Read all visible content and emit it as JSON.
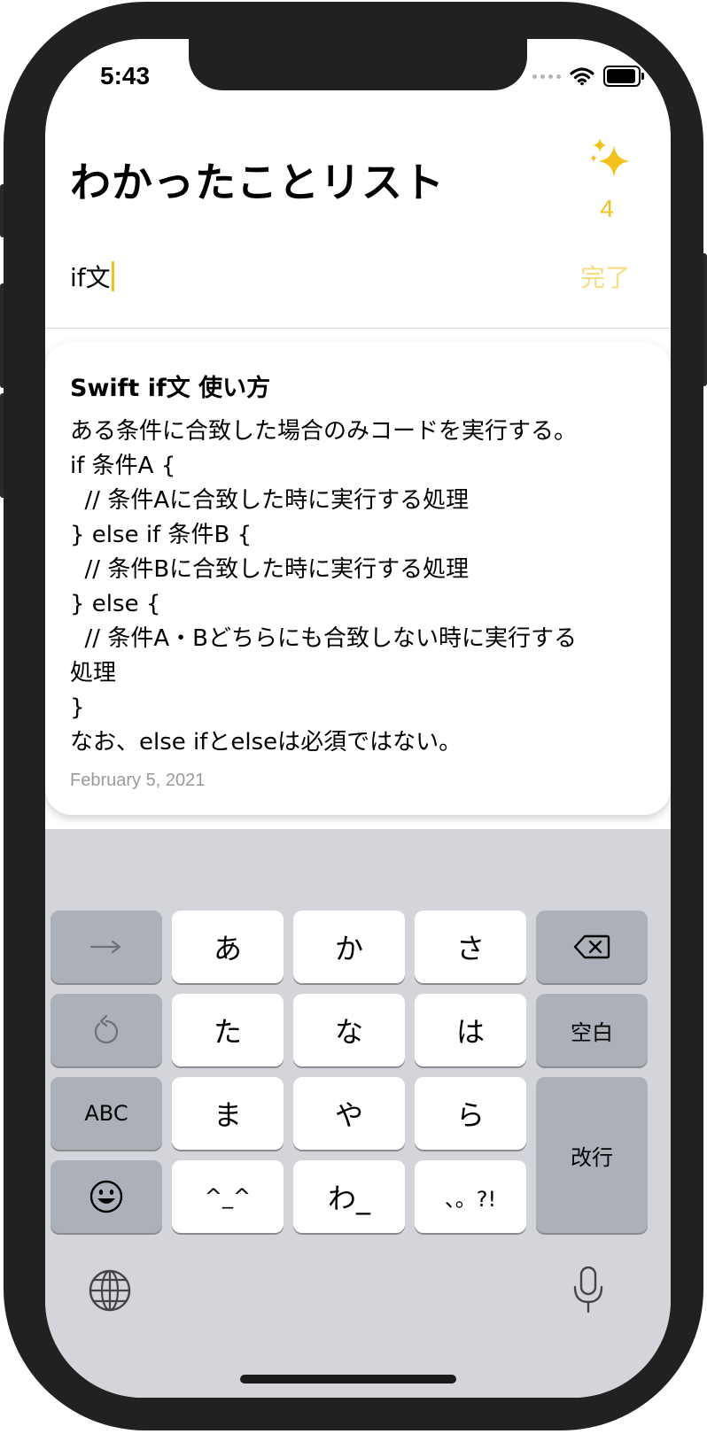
{
  "status_bar": {
    "time": "5:43"
  },
  "header": {
    "title": "わかったことリスト",
    "sparkle_count": "4"
  },
  "input": {
    "value": "if文",
    "done_label": "完了"
  },
  "card": {
    "title": "Swift if文 使い方",
    "body": "ある条件に合致した場合のみコードを実行する。\nif 条件A {\n  // 条件Aに合致した時に実行する処理\n} else if 条件B {\n  // 条件Bに合致した時に実行する処理\n} else {\n  // 条件A・Bどちらにも合致しない時に実行する\n処理\n}\nなお、else ifとelseは必須ではない。",
    "date": "February 5, 2021"
  },
  "keyboard": {
    "row1": [
      "あ",
      "か",
      "さ"
    ],
    "row2": [
      "た",
      "な",
      "は"
    ],
    "row3": [
      "ま",
      "や",
      "ら"
    ],
    "row4": [
      "^_^",
      "わ_",
      "、。?!"
    ],
    "abc": "ABC",
    "space": "空白",
    "return": "改行"
  },
  "colors": {
    "accent": "#f2c21c",
    "done_disabled": "#f7dc83",
    "keyboard_bg": "#d3d5db"
  }
}
